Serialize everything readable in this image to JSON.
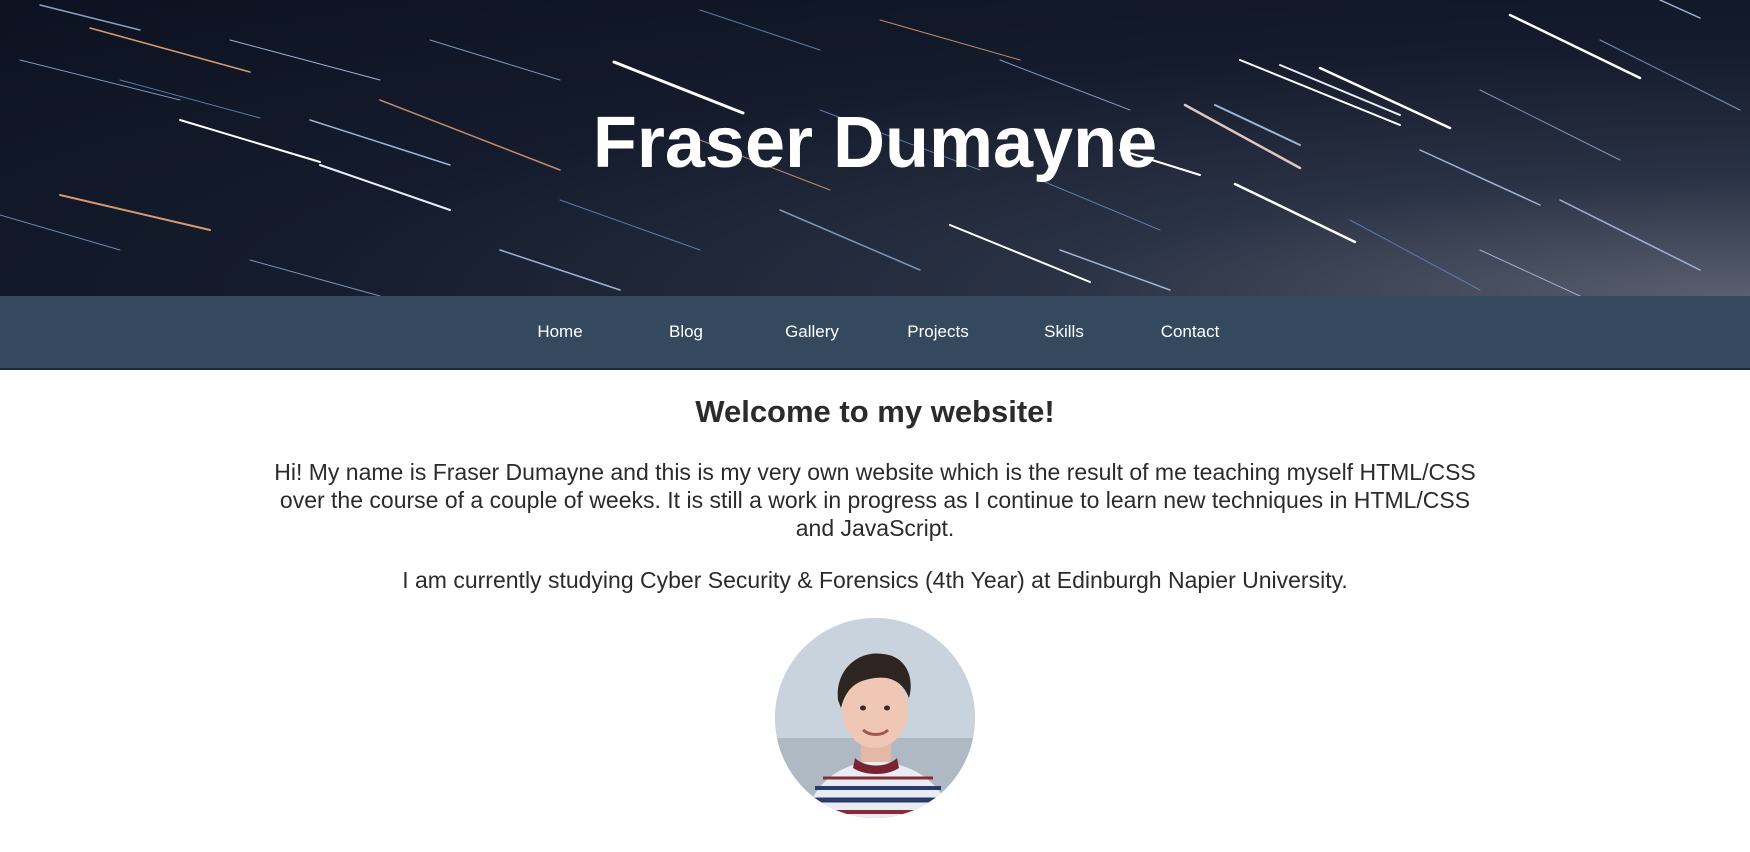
{
  "header": {
    "title": "Fraser Dumayne"
  },
  "nav": {
    "items": [
      "Home",
      "Blog",
      "Gallery",
      "Projects",
      "Skills",
      "Contact"
    ]
  },
  "main": {
    "heading": "Welcome to my website!",
    "intro": "Hi! My name is Fraser Dumayne and this is my very own website which is the result of me teaching myself HTML/CSS over the course of a couple of weeks. It is still a work in progress as I continue to learn new techniques in HTML/CSS and JavaScript.",
    "study": "I am currently studying Cyber Security & Forensics (4th Year) at Edinburgh Napier University."
  },
  "colors": {
    "nav_background": "#34495e",
    "hero_background": "#141b2c",
    "text": "#2b2b2b"
  }
}
